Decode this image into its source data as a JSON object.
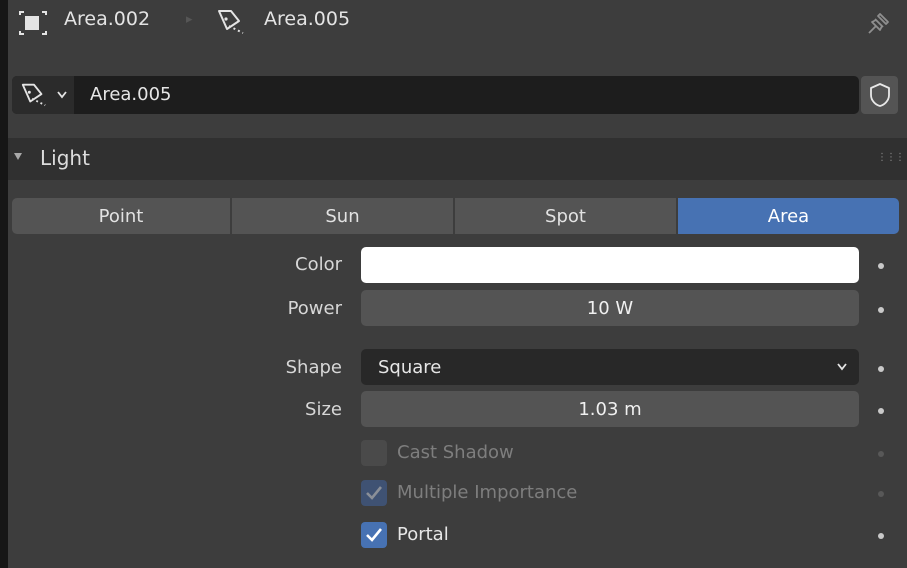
{
  "breadcrumb": {
    "object_name": "Area.002",
    "light_name": "Area.005"
  },
  "datablock": {
    "name": "Area.005"
  },
  "panel": {
    "title": "Light"
  },
  "light_types": {
    "point": "Point",
    "sun": "Sun",
    "spot": "Spot",
    "area": "Area",
    "active": "Area"
  },
  "properties": {
    "color_label": "Color",
    "color_value": "#ffffff",
    "power_label": "Power",
    "power_value": "10 W",
    "shape_label": "Shape",
    "shape_value": "Square",
    "size_label": "Size",
    "size_value": "1.03 m"
  },
  "options": {
    "cast_shadow_label": "Cast Shadow",
    "cast_shadow_checked": false,
    "cast_shadow_enabled": false,
    "multiple_importance_label": "Multiple Importance",
    "multiple_importance_checked": true,
    "multiple_importance_enabled": false,
    "portal_label": "Portal",
    "portal_checked": true,
    "portal_enabled": true
  },
  "colors": {
    "accent": "#4772b3",
    "background": "#3d3d3d",
    "field": "#545454"
  },
  "icons": {
    "object": "object-icon",
    "light": "area-light-icon",
    "pin": "pin-icon",
    "fake_user": "shield-icon",
    "checkmark": "checkmark-icon"
  }
}
